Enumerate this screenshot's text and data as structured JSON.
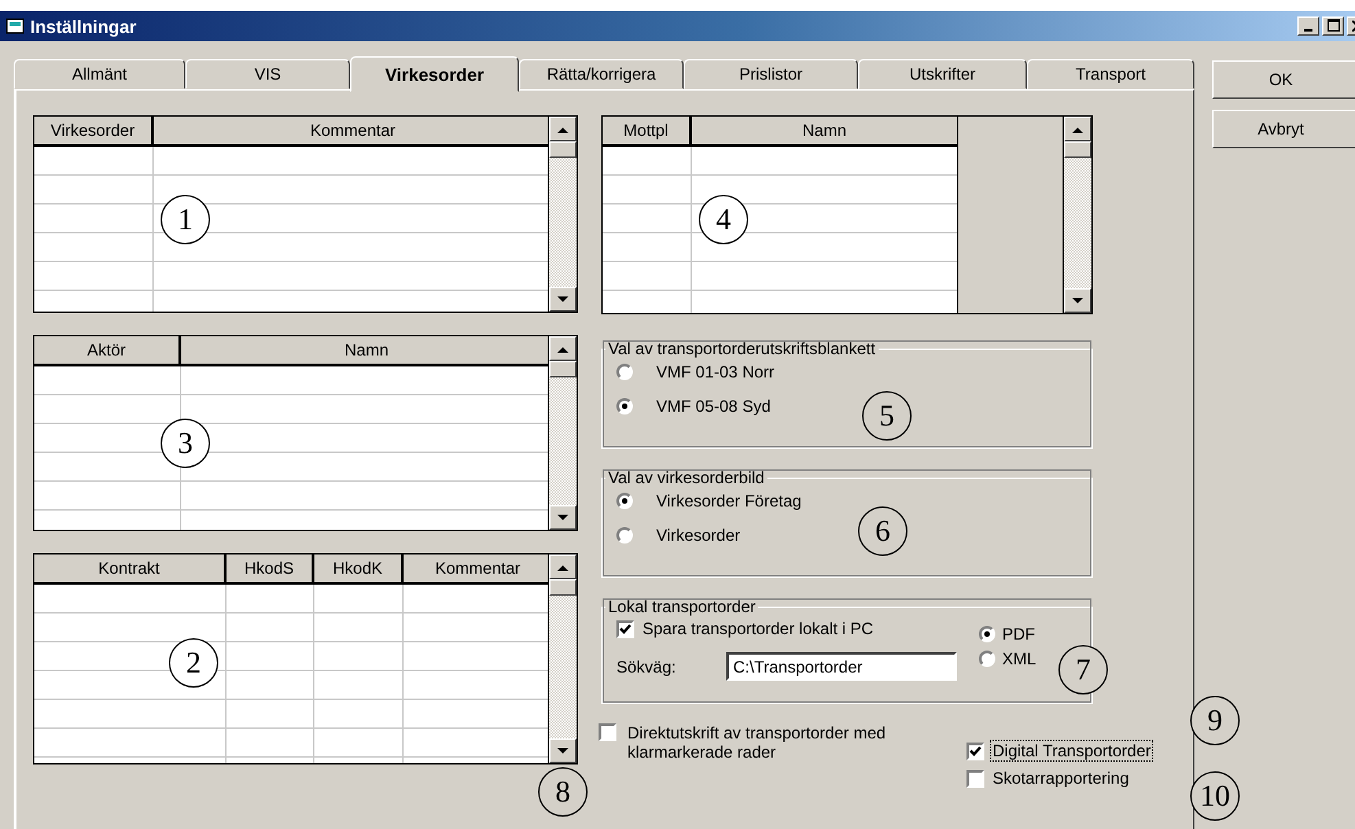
{
  "window": {
    "title": "Inställningar"
  },
  "tabs": [
    {
      "label": "Allmänt",
      "selected": false
    },
    {
      "label": "VIS",
      "selected": false
    },
    {
      "label": "Virkesorder",
      "selected": true
    },
    {
      "label": "Rätta/korrigera",
      "selected": false
    },
    {
      "label": "Prislistor",
      "selected": false
    },
    {
      "label": "Utskrifter",
      "selected": false
    },
    {
      "label": "Transport",
      "selected": false
    }
  ],
  "left_tables": [
    {
      "columns": [
        "Virkesorder",
        "Kommentar"
      ]
    },
    {
      "columns": [
        "Aktör",
        "Namn"
      ]
    },
    {
      "columns": [
        "Kontrakt",
        "HkodS",
        "HkodK",
        "Kommentar"
      ]
    }
  ],
  "right_table": {
    "columns": [
      "Mottpl",
      "Namn"
    ]
  },
  "option_groups": [
    {
      "legend": "Val av transportorderutskriftsblankett",
      "options": [
        {
          "label": "VMF 01-03 Norr",
          "selected": false
        },
        {
          "label": "VMF 05-08 Syd",
          "selected": true
        }
      ]
    },
    {
      "legend": "Val av virkesorderbild",
      "options": [
        {
          "label": "Virkesorder Företag",
          "selected": true
        },
        {
          "label": "Virkesorder",
          "selected": false
        }
      ]
    }
  ],
  "local_group": {
    "legend": "Lokal transportorder",
    "save_checkbox": {
      "label": "Spara transportorder lokalt i PC",
      "checked": true
    },
    "path_label": "Sökväg:",
    "path_value": "C:\\Transportorder",
    "formats": [
      {
        "label": "PDF",
        "selected": true
      },
      {
        "label": "XML",
        "selected": false
      }
    ]
  },
  "direct_print": {
    "label": "Direktutskrift av transportorder med klarmarkerade rader",
    "checked": false
  },
  "extra_checkboxes": [
    {
      "label": "Digital Transportorder",
      "checked": true,
      "focused": true
    },
    {
      "label": "Skotarrapportering",
      "checked": false,
      "focused": false
    }
  ],
  "buttons": [
    "OK",
    "Avbryt"
  ],
  "callouts": [
    "1",
    "2",
    "3",
    "4",
    "5",
    "6",
    "7",
    "8",
    "9",
    "10"
  ]
}
